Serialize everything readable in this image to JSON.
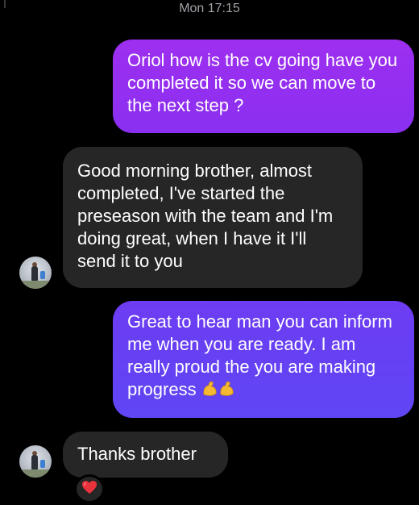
{
  "timestamp": "Mon 17:15",
  "messages": [
    {
      "direction": "outgoing",
      "text": "Oriol how is the cv going have you completed it so we can move to the next step ?"
    },
    {
      "direction": "incoming",
      "text": "Good morning brother, almost completed, I've started the preseason with the team and I'm doing great, when I have it I'll send it to you"
    },
    {
      "direction": "outgoing",
      "text": "Great to hear man you can inform me when you are ready. I am really proud the you are making progress",
      "emoji": "flexed-biceps x2"
    },
    {
      "direction": "incoming",
      "text": "Thanks brother",
      "reaction": "red-heart"
    }
  ],
  "colors": {
    "background": "#000000",
    "incoming_bubble": "#262626",
    "outgoing_bubble_top": "#9e2ff0",
    "outgoing_bubble_bottom": "#5f46f4",
    "timestamp": "#a0a0a8"
  }
}
